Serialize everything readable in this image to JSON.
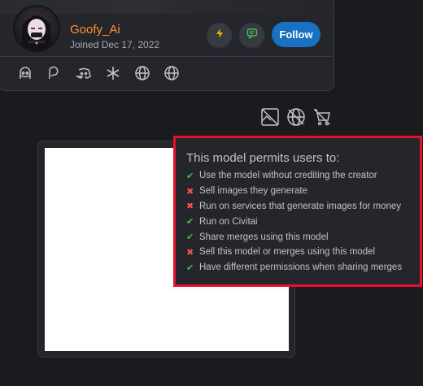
{
  "user": {
    "name": "Goofy_Ai",
    "joined": "Joined Dec 17, 2022",
    "follow_label": "Follow",
    "tip_icon": "lightning-icon",
    "message_icon": "message-icon",
    "social_icons": [
      "ghost-icon",
      "patreon-icon",
      "discord-icon",
      "sparkle-icon",
      "globe-icon",
      "globe-icon"
    ]
  },
  "license_icons": [
    "no-image-icon",
    "no-globe-icon",
    "no-cart-icon"
  ],
  "permissions": {
    "title": "This model permits users to:",
    "items": [
      {
        "label": "Use the model without crediting the creator",
        "allowed": true
      },
      {
        "label": "Sell images they generate",
        "allowed": false
      },
      {
        "label": "Run on services that generate images for money",
        "allowed": false
      },
      {
        "label": "Run on Civitai",
        "allowed": true
      },
      {
        "label": "Share merges using this model",
        "allowed": true
      },
      {
        "label": "Sell this model or merges using this model",
        "allowed": false
      },
      {
        "label": "Have different permissions when sharing merges",
        "allowed": true
      }
    ]
  },
  "colors": {
    "accent": "#1971c2",
    "username": "#ff922b",
    "highlight_border": "#e8112d",
    "allowed": "#40c057",
    "denied": "#fa5252"
  }
}
